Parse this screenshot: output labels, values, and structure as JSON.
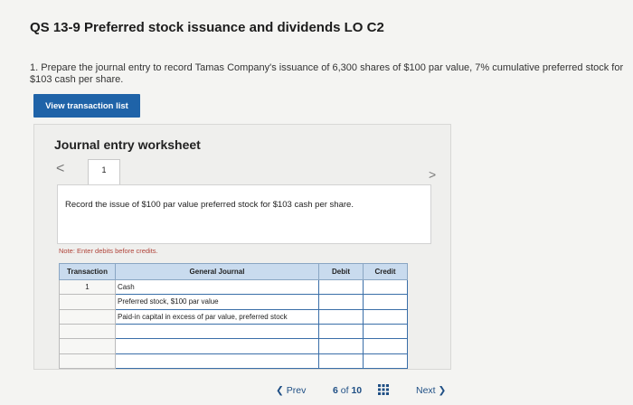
{
  "header": {
    "title": "QS 13-9 Preferred stock issuance and dividends LO C2"
  },
  "question": {
    "text": "1. Prepare the journal entry to record Tamas Company's issuance of 6,300 shares of $100 par value, 7% cumulative preferred stock for $103 cash per share."
  },
  "buttons": {
    "view_transactions": "View transaction list"
  },
  "worksheet": {
    "title": "Journal entry worksheet",
    "prev_symbol": "<",
    "next_symbol": ">",
    "tab_number": "1",
    "description": "Record the issue of $100 par value preferred stock for $103 cash per share.",
    "note": "Note: Enter debits before credits."
  },
  "journal": {
    "headers": [
      "Transaction",
      "General Journal",
      "Debit",
      "Credit"
    ],
    "rows": [
      {
        "transaction": "1",
        "account": "Cash",
        "debit": "",
        "credit": ""
      },
      {
        "transaction": "",
        "account": "Preferred stock, $100 par value",
        "debit": "",
        "credit": ""
      },
      {
        "transaction": "",
        "account": "Paid-in capital in excess of par value, preferred stock",
        "debit": "",
        "credit": ""
      },
      {
        "transaction": "",
        "account": "",
        "debit": "",
        "credit": ""
      },
      {
        "transaction": "",
        "account": "",
        "debit": "",
        "credit": ""
      },
      {
        "transaction": "",
        "account": "",
        "debit": "",
        "credit": ""
      }
    ]
  },
  "pagination": {
    "prev_label": "Prev",
    "current": "6",
    "of_label": "of",
    "total": "10",
    "next_label": "Next",
    "grid_icon": "grid-icon"
  },
  "colors": {
    "button_bg": "#1f63a8",
    "header_bg": "#c9dbee",
    "note_color": "#b0443a",
    "nav_color": "#1f4f85"
  }
}
